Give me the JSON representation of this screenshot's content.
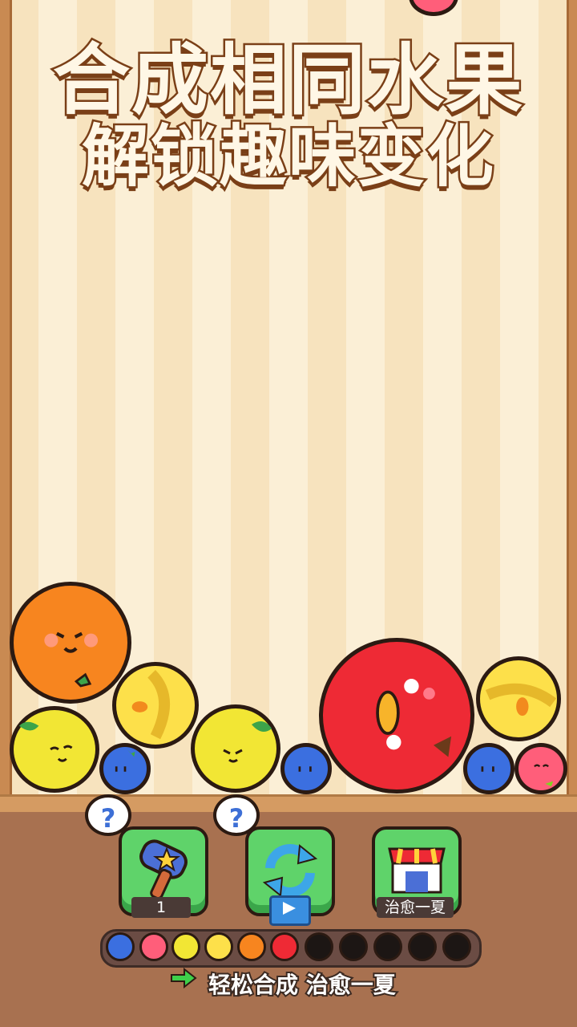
{
  "titles": {
    "line1": "合成相同水果",
    "line2": "解锁趣味变化"
  },
  "tools": [
    {
      "name": "hammer",
      "icon": "hammer-star-icon",
      "badge": "1"
    },
    {
      "name": "shuffle",
      "icon": "refresh-arrows-icon",
      "badge": "video-icon"
    },
    {
      "name": "shop",
      "icon": "shop-awning-icon",
      "badge": "治愈一夏"
    }
  ],
  "hint_bubbles": [
    "?",
    "?"
  ],
  "fruit_progress": [
    "blueberry",
    "strawberry",
    "lemon",
    "banana",
    "orange",
    "apple",
    "locked",
    "locked",
    "locked",
    "locked",
    "locked"
  ],
  "tagline": "轻松合成 治愈一夏",
  "colors": {
    "orange": "#f7851f",
    "lemon": "#f2e634",
    "banana": "#fde04a",
    "blueberry": "#3b6fe0",
    "apple": "#ee2a35",
    "peach": "#ff5e7a",
    "green_button": "#5fd36a"
  }
}
